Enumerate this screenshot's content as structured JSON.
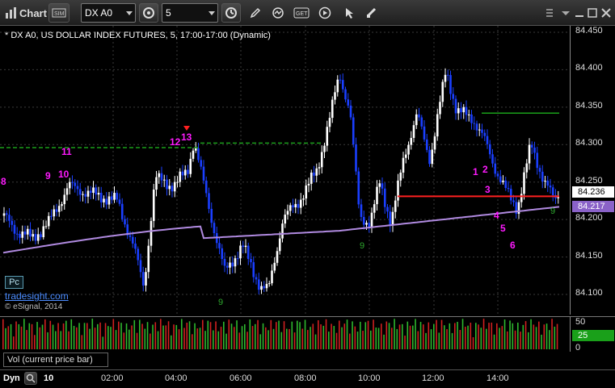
{
  "toolbar": {
    "chart_label": "Chart",
    "symbol": "DX A0",
    "interval": "5",
    "icons": [
      "window-icon",
      "refresh-icon",
      "clock-icon",
      "pencil-icon",
      "cycle-icon",
      "get-icon",
      "play-icon",
      "cursor-icon",
      "rectangle-icon",
      "help-icon",
      "menu-icon",
      "minimize-icon",
      "maximize-icon",
      "close-icon"
    ]
  },
  "chart": {
    "title": "* DX A0, US DOLLAR INDEX FUTURES, 5, 17:00-17:00 (Dynamic)",
    "pc_button": "Pc",
    "watermark_1": "tradesight.com",
    "watermark_2": "© eSignal, 2014",
    "colors": {
      "up": "#ffffff",
      "down": "#1a3fff",
      "ma": "#b08ae0",
      "red_line": "#ff2020",
      "green_line": "#1aa01a",
      "magenta": "#ff1aff",
      "green_count": "#2ea82e"
    }
  },
  "price_axis": {
    "ticks": [
      "84.450",
      "84.400",
      "84.350",
      "84.300",
      "84.250",
      "84.200",
      "84.150",
      "84.100"
    ],
    "last_price": "84.236",
    "ma_value": "84.217"
  },
  "volume": {
    "legend": "Vol (current price bar)",
    "ticks": [
      "50",
      "25",
      "0"
    ],
    "current": "25"
  },
  "time_axis": {
    "mode_label": "Dyn",
    "ticks": [
      "10",
      "02:00",
      "04:00",
      "06:00",
      "08:00",
      "10:00",
      "12:00",
      "14:00"
    ]
  },
  "annotations": {
    "magenta": [
      "8",
      "9",
      "10",
      "11",
      "12",
      "13",
      "1",
      "2",
      "3",
      "4",
      "5",
      "6"
    ],
    "green_nines": [
      "9",
      "9",
      "9"
    ]
  }
}
